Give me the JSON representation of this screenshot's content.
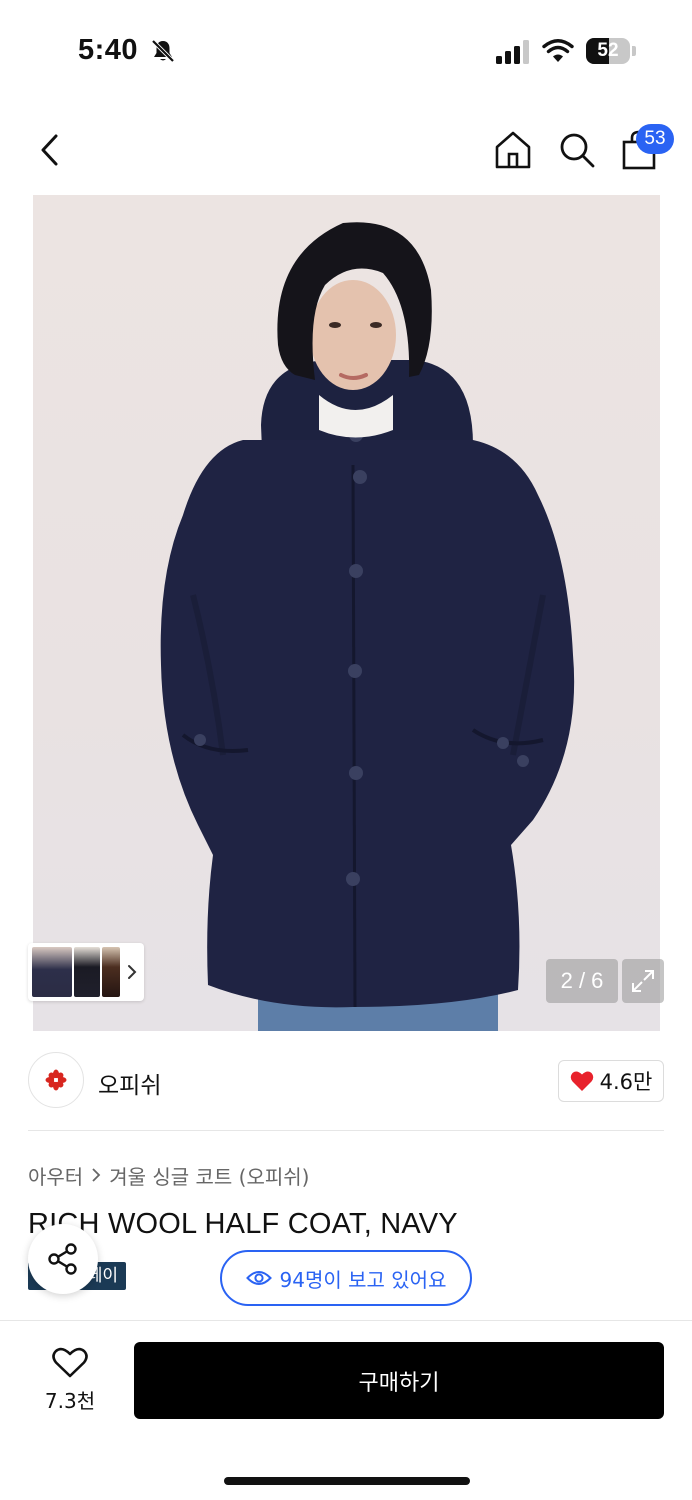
{
  "status_bar": {
    "time": "5:40",
    "battery_level": "52",
    "battery_fraction": 0.52,
    "icons": [
      "bell-off-icon",
      "cellular-signal-icon",
      "wifi-icon",
      "battery-icon"
    ]
  },
  "header": {
    "icons": [
      "back-chevron-icon",
      "home-icon",
      "search-icon",
      "shopping-bag-icon"
    ],
    "cart_count": "53"
  },
  "gallery": {
    "page_indicator": "2 / 6",
    "expand_icon": "expand-arrows-icon",
    "thumbnail_chevron_icon": "chevron-right-icon"
  },
  "brand": {
    "name": "오피쉬",
    "logo_icon": "red-flower-logo",
    "like_count": "4.6만",
    "like_icon": "heart-filled-icon"
  },
  "breadcrumb": {
    "category": "아우터",
    "subcategory": "겨울 싱글 코트 (오피쉬)"
  },
  "product": {
    "title": "RICH WOOL HALF COAT, NAVY",
    "promo_tag": "페이"
  },
  "viewers": {
    "text": "94명이 보고 있어요",
    "icon": "eye-icon"
  },
  "bottom_bar": {
    "wishlist_count": "7.3천",
    "wishlist_icon": "heart-outline-icon",
    "buy_label": "구매하기"
  },
  "colors": {
    "accent_blue": "#2a63f3",
    "buy_button": "#000000",
    "heart_red": "#e8222c",
    "promo_tag": "#1b3a55"
  }
}
